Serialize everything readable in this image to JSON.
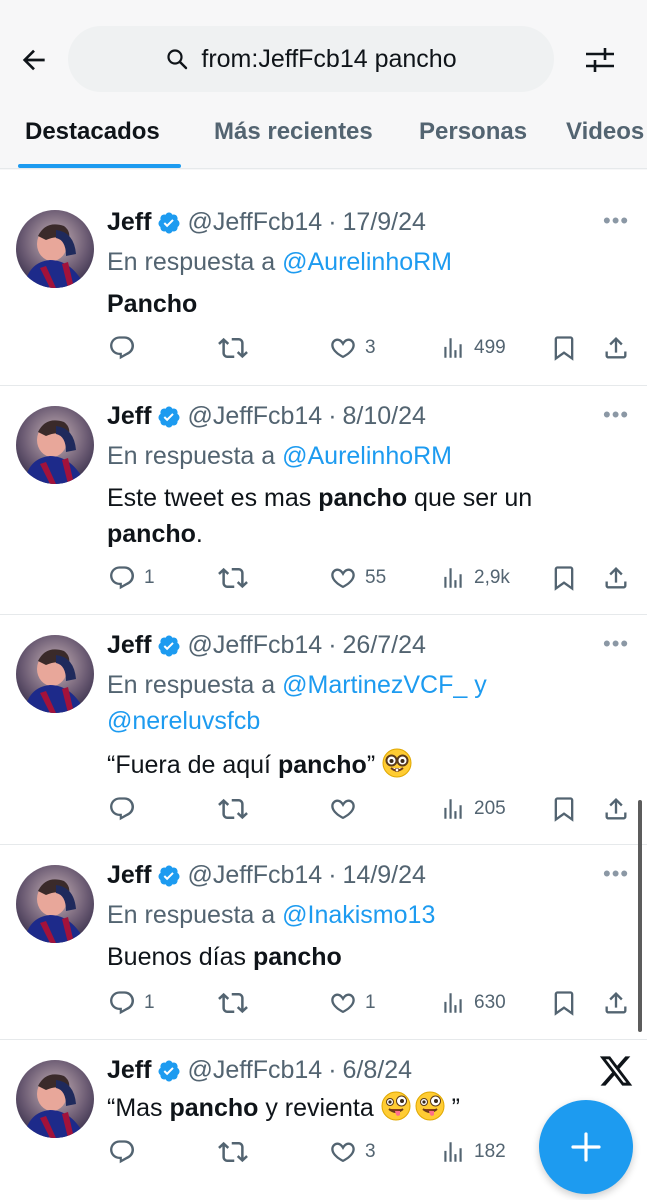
{
  "search": {
    "query": "from:JeffFcb14 pancho"
  },
  "tabs": [
    {
      "label": "Destacados",
      "active": true
    },
    {
      "label": "Más recientes",
      "active": false
    },
    {
      "label": "Personas",
      "active": false
    },
    {
      "label": "Videos",
      "active": false
    }
  ],
  "colors": {
    "accent": "#1d9bf0",
    "text": "#0f1419",
    "muted": "#536471"
  },
  "tweets": [
    {
      "name": "Jeff",
      "handle": "@JeffFcb14",
      "sep": "·",
      "date": "17/9/24",
      "reply_prefix": "En respuesta a",
      "reply_to": "@AurelinhoRM",
      "reply_to_2": "",
      "reply_and": "",
      "text_parts": [
        "",
        "Pancho",
        "",
        "",
        ""
      ],
      "replies": "",
      "retweets": "",
      "likes": "3",
      "views": "499"
    },
    {
      "name": "Jeff",
      "handle": "@JeffFcb14",
      "sep": "·",
      "date": "8/10/24",
      "reply_prefix": "En respuesta a",
      "reply_to": "@AurelinhoRM",
      "reply_to_2": "",
      "reply_and": "",
      "text_parts": [
        "Este tweet es mas ",
        "pancho",
        " que ser un ",
        "pancho",
        "."
      ],
      "replies": "1",
      "retweets": "",
      "likes": "55",
      "views": "2,9k"
    },
    {
      "name": "Jeff",
      "handle": "@JeffFcb14",
      "sep": "·",
      "date": "26/7/24",
      "reply_prefix": "En respuesta a",
      "reply_to": "@MartinezVCF_",
      "reply_and": "y",
      "reply_to_2": "@nereluvsfcb",
      "text_parts": [
        "“Fuera de aquí ",
        "pancho",
        "” ",
        "",
        ""
      ],
      "emoji": "nerd-face-emoji",
      "replies": "",
      "retweets": "",
      "likes": "",
      "views": "205"
    },
    {
      "name": "Jeff",
      "handle": "@JeffFcb14",
      "sep": "·",
      "date": "14/9/24",
      "reply_prefix": "En respuesta a",
      "reply_to": "@Inakismo13",
      "reply_to_2": "",
      "reply_and": "",
      "text_parts": [
        "Buenos días ",
        "pancho",
        "",
        "",
        ""
      ],
      "replies": "1",
      "retweets": "",
      "likes": "1",
      "views": "630"
    },
    {
      "name": "Jeff",
      "handle": "@JeffFcb14",
      "sep": "·",
      "date": "6/8/24",
      "reply_prefix": "",
      "reply_to": "",
      "reply_to_2": "",
      "reply_and": "",
      "text_parts": [
        "“Mas ",
        "pancho",
        " y revienta ",
        "",
        "”"
      ],
      "emoji": "zany-face-emoji",
      "replies": "",
      "retweets": "",
      "likes": "3",
      "views": "182"
    }
  ]
}
